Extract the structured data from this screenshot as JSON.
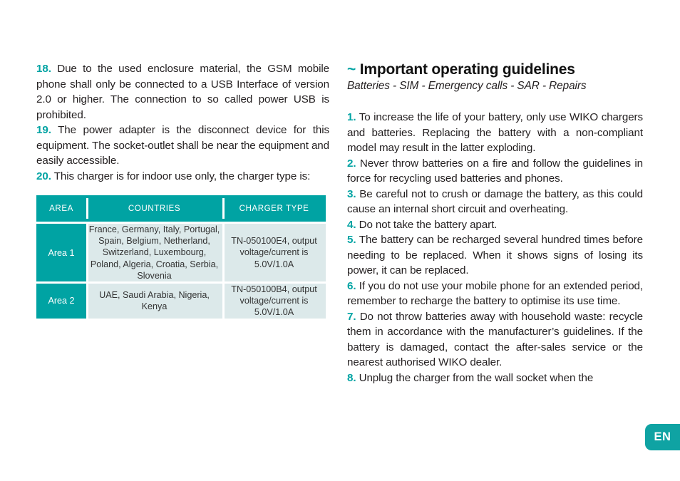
{
  "theme": {
    "accent": "#00a3a3",
    "text": "#231f20",
    "table_header_bg": "#00a3a3",
    "table_cell_bg": "#dce9ea",
    "tab_bg": "#0fa3a3"
  },
  "left_column": {
    "paragraphs": [
      {
        "number": "18.",
        "text": "Due to the used enclosure material, the GSM mobile phone shall only be connected to a USB Interface of version 2.0 or higher. The connection to so called power USB is prohibited."
      },
      {
        "number": "19.",
        "text": "The power adapter is the disconnect device for this equipment. The socket-outlet shall be near the equipment and easily accessible."
      },
      {
        "number": "20.",
        "text": "This charger is for indoor use only, the charger type is:"
      }
    ],
    "table": {
      "headers": [
        "AREA",
        "COUNTRIES",
        "CHARGER TYPE"
      ],
      "rows": [
        {
          "area": "Area 1",
          "countries": "France, Germany, Italy, Portugal, Spain, Belgium, Netherland, Switzerland, Luxembourg, Poland, Algeria, Croatia, Serbia, Slovenia",
          "charger_type": "TN-050100E4, output voltage/current is 5.0V/1.0A"
        },
        {
          "area": "Area 2",
          "countries": "UAE, Saudi Arabia, Nigeria, Kenya",
          "charger_type": "TN-050100B4, output voltage/current is 5.0V/1.0A"
        }
      ]
    }
  },
  "right_column": {
    "heading_marker": "~",
    "heading": "Important operating guidelines",
    "subheading": "Batteries - SIM - Emergency calls - SAR - Repairs",
    "paragraphs": [
      {
        "number": "1.",
        "text": "To increase the life of your battery, only use WIKO chargers and batteries. Replacing the battery with a non-compliant model may result in the latter exploding."
      },
      {
        "number": "2.",
        "text": "Never throw batteries on a fire and follow the guidelines in force for recycling used batteries and phones."
      },
      {
        "number": "3.",
        "text": "Be careful not to crush or damage the battery, as this could cause an internal short circuit and overheating."
      },
      {
        "number": "4.",
        "text": "Do not take the battery apart."
      },
      {
        "number": "5.",
        "text": "The battery can be recharged several hundred times before needing to be replaced. When it shows signs of losing its power, it can be replaced."
      },
      {
        "number": "6.",
        "text": "If you do not use your mobile phone for an extended period, remember to recharge the battery to optimise its use time."
      },
      {
        "number": "7.",
        "text": "Do not throw batteries away with household waste: recycle them in accordance with the manufacturer’s guidelines. If the battery is damaged, contact the after-sales service or the nearest authorised WIKO dealer."
      },
      {
        "number": "8.",
        "text": "Unplug the charger from the wall socket when the"
      }
    ]
  },
  "language_tab": {
    "label": "EN"
  }
}
